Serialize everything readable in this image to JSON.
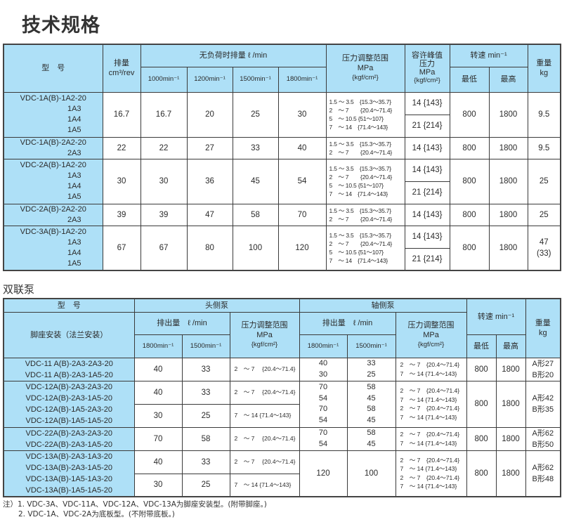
{
  "page_title": "技术规格",
  "single_pump_table": {
    "headers": {
      "model": "型　号",
      "displacement": "排量",
      "displacement_unit": "cm³/rev",
      "no_load_flow": "无负荷时排量 ℓ /min",
      "speeds": [
        "1000min⁻¹",
        "1200min⁻¹",
        "1500min⁻¹",
        "1800min⁻¹"
      ],
      "pressure_range": "压力调整范围",
      "pressure_range_unit": "MPa",
      "pressure_range_unit2": "{kgf/cm²}",
      "peak_pressure": "容许峰值",
      "peak_pressure2": "压力",
      "peak_pressure_unit": "MPa",
      "peak_pressure_unit2": "{kgf/cm²}",
      "rotation": "转速 min⁻¹",
      "rotation_min": "最低",
      "rotation_max": "最高",
      "weight": "重量",
      "weight_unit": "kg"
    },
    "rows": [
      {
        "model_main": "VDC-1A(B)-1A2-20",
        "model_subs": [
          "1A3",
          "1A4",
          "1A5"
        ],
        "displacement": "16.7",
        "flows": [
          "16.7",
          "20",
          "25",
          "30"
        ],
        "pressure_ranges": [
          "1.5 ～ 3.5　{15.3～35.7}",
          "2　～ 7　　{20.4～71.4}",
          "5　～ 10.5 {51～107}",
          "7　～ 14　{71.4～143}"
        ],
        "peak_pressures": [
          "14 {143}",
          "21 {214}"
        ],
        "min_speed": "800",
        "max_speed": "1800",
        "weight": "9.5"
      },
      {
        "model_main": "VDC-1A(B)-2A2-20",
        "model_subs": [
          "2A3"
        ],
        "displacement": "22",
        "flows": [
          "22",
          "27",
          "33",
          "40"
        ],
        "pressure_ranges": [
          "1.5 ～ 3.5　{15.3～35.7}",
          "2　～ 7　　{20.4～71.4}"
        ],
        "peak_pressures": [
          "14 {143}"
        ],
        "min_speed": "800",
        "max_speed": "1800",
        "weight": "9.5"
      },
      {
        "model_main": "VDC-2A(B)-1A2-20",
        "model_subs": [
          "1A3",
          "1A4",
          "1A5"
        ],
        "displacement": "30",
        "flows": [
          "30",
          "36",
          "45",
          "54"
        ],
        "pressure_ranges": [
          "1.5 ～ 3.5　{15.3～35.7}",
          "2　～ 7　　{20.4～71.4}",
          "5　～ 10.5 {51～107}",
          "7　～ 14　{71.4～143}"
        ],
        "peak_pressures": [
          "14 {143}",
          "21 {214}"
        ],
        "min_speed": "800",
        "max_speed": "1800",
        "weight": "25"
      },
      {
        "model_main": "VDC-2A(B)-2A2-20",
        "model_subs": [
          "2A3"
        ],
        "displacement": "39",
        "flows": [
          "39",
          "47",
          "58",
          "70"
        ],
        "pressure_ranges": [
          "1.5 ～ 3.5　{15.3～35.7}",
          "2　～ 7　　{20.4～71.4}"
        ],
        "peak_pressures": [
          "14 {143}"
        ],
        "min_speed": "800",
        "max_speed": "1800",
        "weight": "25"
      },
      {
        "model_main": "VDC-3A(B)-1A2-20",
        "model_subs": [
          "1A3",
          "1A4",
          "1A5"
        ],
        "displacement": "67",
        "flows": [
          "67",
          "80",
          "100",
          "120"
        ],
        "pressure_ranges": [
          "1.5 ～ 3.5　{15.3～35.7}",
          "2　～ 7　　{20.4～71.4}",
          "5　～ 10.5 {51～107}",
          "7　～ 14　{71.4～143}"
        ],
        "peak_pressures": [
          "14 {143}",
          "21 {214}"
        ],
        "min_speed": "800",
        "max_speed": "1800",
        "weight": "47",
        "weight_alt": "(33)"
      }
    ]
  },
  "double_pump_section_title": "双联泵",
  "double_pump_table": {
    "headers": {
      "model": "型　号",
      "mounting": "脚座安装（法兰安装）",
      "head_pump": "头侧泵",
      "shaft_pump": "轴侧泵",
      "flow": "排出量　ℓ /min",
      "speed_1800": "1800min⁻¹",
      "speed_1500": "1500min⁻¹",
      "pressure_range": "压力调整范围",
      "pressure_unit": "MPa",
      "pressure_unit2": "{kgf/cm²}",
      "rotation": "转速 min⁻¹",
      "rotation_min": "最低",
      "rotation_max": "最高",
      "weight": "重量",
      "weight_unit": "kg"
    },
    "groups": [
      {
        "models": [
          "VDC-11 A(B)-2A3-2A3-20",
          "VDC-11 A(B)-2A3-1A5-20"
        ],
        "head_1800": "40",
        "head_1500": "33",
        "head_pressure": "2　～ 7　 {20.4～71.4}",
        "shaft_1800": [
          "40",
          "30"
        ],
        "shaft_1500": [
          "33",
          "25"
        ],
        "shaft_pressure": [
          "2　～ 7　{20.4～71.4}",
          "7　～ 14 {71.4～143}"
        ],
        "min_speed": "800",
        "max_speed": "1800",
        "weight": [
          "A形27",
          "B形20"
        ]
      },
      {
        "models": [
          "VDC-12A(B)-2A3-2A3-20",
          "VDC-12A(B)-2A3-1A5-20",
          "VDC-12A(B)-1A5-2A3-20",
          "VDC-12A(B)-1A5-1A5-20"
        ],
        "head_sub": [
          {
            "head_1800": "40",
            "head_1500": "33",
            "head_pressure": "2　～ 7　 {20.4～71.4}"
          },
          {
            "head_1800": "30",
            "head_1500": "25",
            "head_pressure": "7　～ 14 {71.4～143}"
          }
        ],
        "shaft_1800": [
          "70",
          "54",
          "70",
          "54"
        ],
        "shaft_1500": [
          "58",
          "45",
          "58",
          "45"
        ],
        "shaft_pressure": [
          "2　～ 7　{20.4～71.4}",
          "7　～ 14 {71.4～143}",
          "2　～ 7　{20.4～71.4}",
          "7　～ 14 {71.4～143}"
        ],
        "min_speed": "800",
        "max_speed": "1800",
        "weight": [
          "A形42",
          "B形35"
        ]
      },
      {
        "models": [
          "VDC-22A(B)-2A3-2A3-20",
          "VDC-22A(B)-2A3-1A5-20"
        ],
        "head_1800": "70",
        "head_1500": "58",
        "head_pressure": "2　～ 7　 {20.4～71.4}",
        "shaft_1800": [
          "70",
          "54"
        ],
        "shaft_1500": [
          "58",
          "45"
        ],
        "shaft_pressure": [
          "2　～ 7　{20.4～71.4}",
          "7　～ 14 {71.4～143}"
        ],
        "min_speed": "800",
        "max_speed": "1800",
        "weight": [
          "A形62",
          "B形50"
        ]
      },
      {
        "models": [
          "VDC-13A(B)-2A3-1A3-20",
          "VDC-13A(B)-2A3-1A5-20",
          "VDC-13A(B)-1A5-1A3-20",
          "VDC-13A(B)-1A5-1A5-20"
        ],
        "head_sub": [
          {
            "head_1800": "40",
            "head_1500": "33",
            "head_pressure": "2　～ 7　 {20.4～71.4}"
          },
          {
            "head_1800": "30",
            "head_1500": "25",
            "head_pressure": "7　～ 14 {71.4～143}"
          }
        ],
        "shaft_1800": "120",
        "shaft_1500": "100",
        "shaft_pressure": [
          "2　～ 7　{20.4～71.4}",
          "7　～ 14 {71.4～143}",
          "2　～ 7　{20.4～71.4}",
          "7　～ 14 {71.4～143}"
        ],
        "min_speed": "800",
        "max_speed": "1800",
        "weight": [
          "A形62",
          "B形48"
        ]
      }
    ]
  },
  "notes": {
    "line1": "注）1. VDC-3A、VDC-11A、VDC-12A、VDC-13A为脚座安装型。(附带脚座。)",
    "line2": "2. VDC-1A、VDC-2A为底板型。(不附带底板。)"
  }
}
